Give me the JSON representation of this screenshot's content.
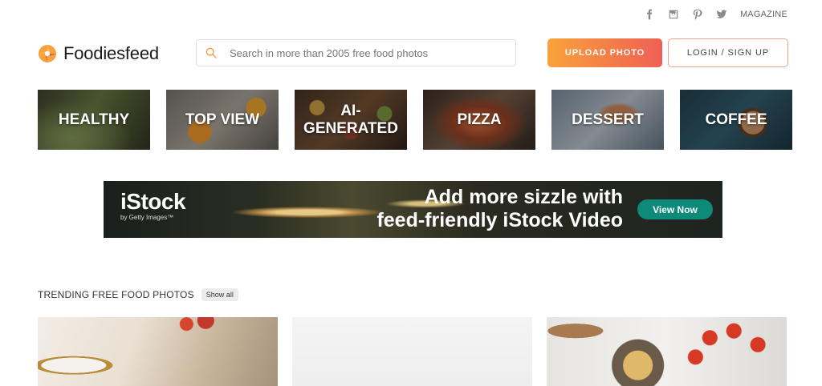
{
  "topbar": {
    "social": [
      "facebook-icon",
      "instagram-icon",
      "pinterest-icon",
      "twitter-icon"
    ],
    "magazine_label": "MAGAZINE"
  },
  "header": {
    "logo_text": "Foodiesfeed",
    "search_placeholder": "Search in more than 2005 free food photos",
    "upload_label": "UPLOAD PHOTO",
    "login_label": "LOGIN / SIGN UP"
  },
  "categories": [
    {
      "label": "HEALTHY"
    },
    {
      "label": "TOP VIEW"
    },
    {
      "label": "AI-\nGENERATED"
    },
    {
      "label": "PIZZA"
    },
    {
      "label": "DESSERT"
    },
    {
      "label": "COFFEE"
    }
  ],
  "ad": {
    "brand": "iStock",
    "brand_sub": "by Getty Images™",
    "headline_line1": "Add more sizzle with",
    "headline_line2": "feed-friendly iStock Video",
    "cta": "View Now"
  },
  "trending": {
    "title": "TRENDING FREE FOOD PHOTOS",
    "show_all": "Show all"
  },
  "colors": {
    "accent_start": "#f9a23b",
    "accent_end": "#ef5f55",
    "cta_green": "#0e8a7a"
  }
}
